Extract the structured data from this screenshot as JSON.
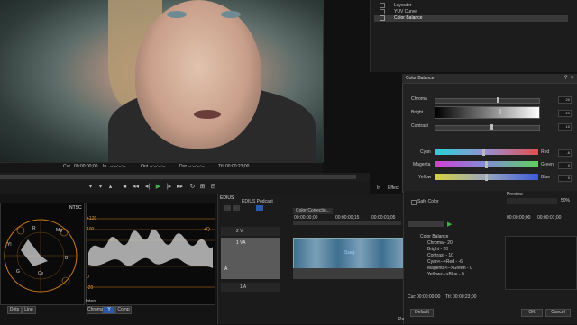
{
  "layers": {
    "items": [
      "Layouter",
      "YUV Curve",
      "Color Balance"
    ]
  },
  "timecode": {
    "cur_label": "Cur",
    "cur_value": "00:00:00;00",
    "in_label": "In",
    "in_value": "--:--:--:--",
    "out_label": "Out",
    "out_value": "--:--:--:--",
    "dur_label": "Dur",
    "dur_value": "--:--:--:--",
    "ttl_label": "Ttl",
    "ttl_value": "00:00:23;00"
  },
  "color_balance": {
    "title": "Color Balance",
    "chroma_label": "Chroma",
    "chroma_value": "20",
    "bright_label": "Bright",
    "bright_value": "20",
    "contrast_label": "Contrast",
    "contrast_value": "10",
    "cyan_label": "Cyan",
    "red_label": "Red",
    "cyan_red_value": "-6",
    "magenta_label": "Magenta",
    "green_label": "Green",
    "magenta_green_value": "0",
    "yellow_label": "Yellow",
    "blue_label": "Blue",
    "yellow_blue_value": "0",
    "levels": {
      "chroma": 0.61,
      "bright": 0.63,
      "contrast": 0.55,
      "cyan_red": 0.47,
      "magenta_green": 0.5,
      "yellow_blue": 0.5
    },
    "in_tab": "In",
    "effect_tab": "Effect"
  },
  "scopes": {
    "ntsc": "NTSC",
    "vectorscope_labels": [
      "R",
      "Mg",
      "Yl",
      "B",
      "G",
      "Cy"
    ],
    "waveform_ticks": [
      "+120",
      "100",
      "+Q",
      "0",
      "-20"
    ],
    "buttons_left": [
      "Dots",
      "Line"
    ],
    "waveform_buttons": [
      "Chroma",
      "Y",
      "Comp"
    ],
    "inten_label": "Inten."
  },
  "timeline": {
    "app_label": "EDIUS",
    "project_label": "EDIUS Podcast",
    "sequence_label": "Color Correctio...",
    "time_start": "00:00:00;00",
    "time_mid": "00:00:00;15",
    "time_end": "00:00:01;05",
    "tracks": [
      "2 V",
      "1 VA",
      "A",
      "1 A"
    ],
    "clip_label": "Ssag"
  },
  "color_correction": {
    "title": "Preview",
    "safe_color_label": "Safe Color",
    "zoom_value": "50%",
    "tree_items": [
      "Color Balance",
      "Chroma - 20",
      "Bright - 20",
      "Contrast - 10",
      "Cyan<-->Red - -6",
      "Magenta<-->Green - 0",
      "Yellow<-->Blue - 0"
    ],
    "cur_label": "Cur:",
    "cur_value": "00:00:00;00",
    "ttl_label": "Ttl:",
    "ttl_value": "00:00:23;00",
    "time_start": "00:00:00;00",
    "time_end": "00:00:01;00",
    "default_button": "Default",
    "ok_button": "OK",
    "cancel_button": "Cancel"
  },
  "status": {
    "pa_label": "Pa"
  }
}
